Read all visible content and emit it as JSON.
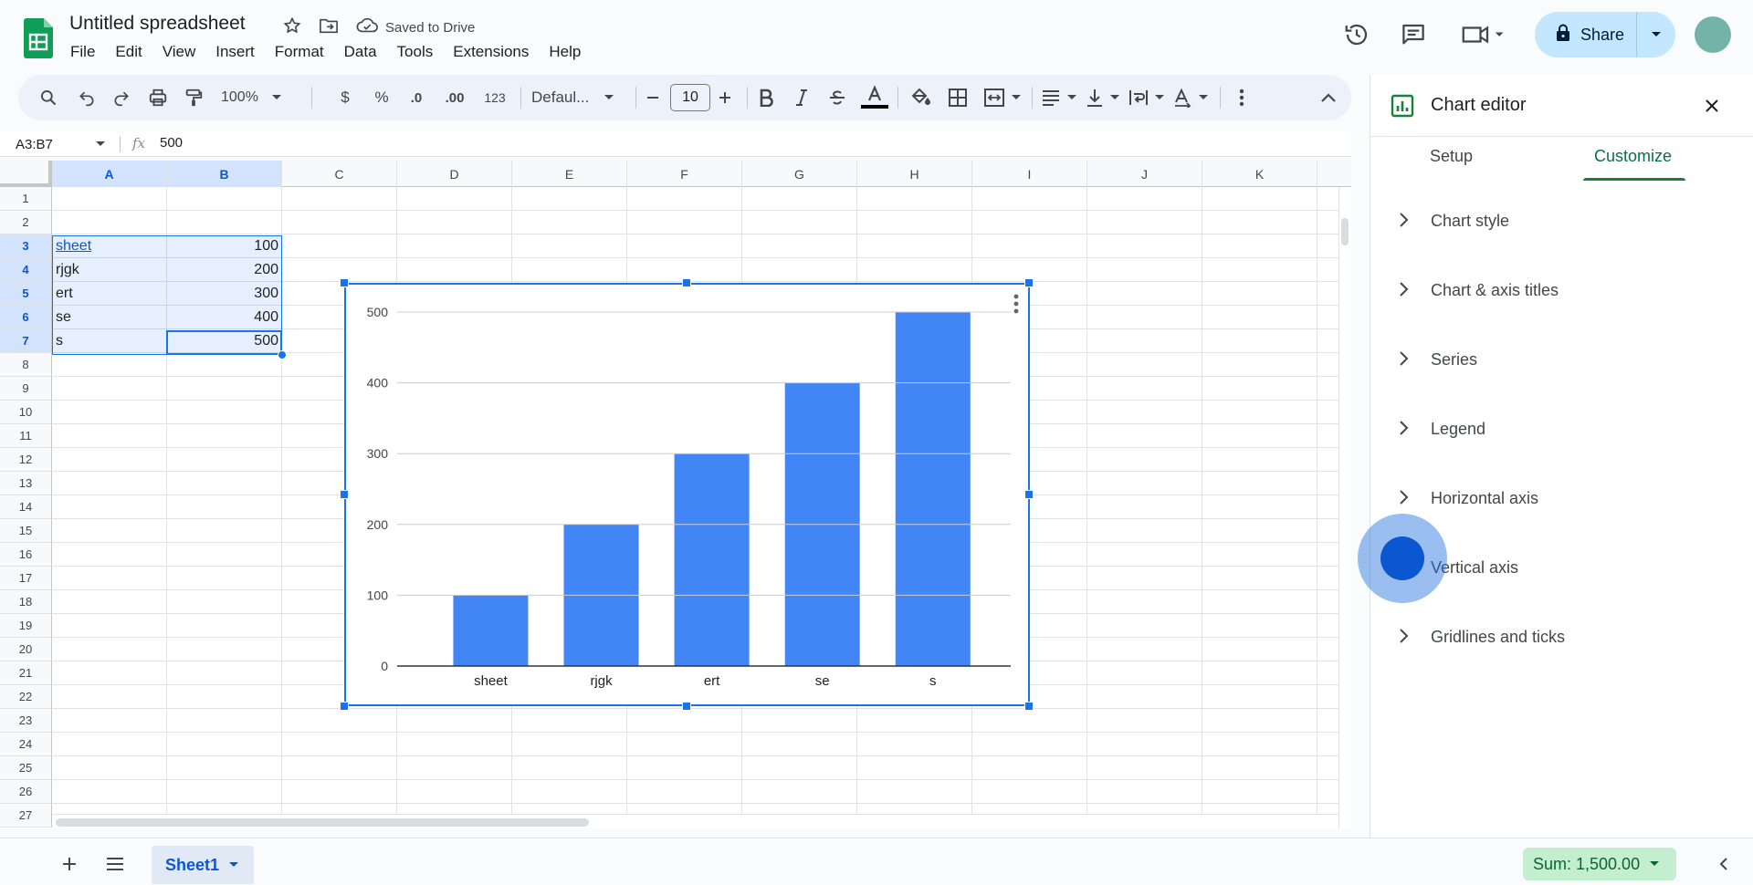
{
  "title_bar": {
    "doc_title": "Untitled spreadsheet",
    "saved_status": "Saved to Drive",
    "share_label": "Share"
  },
  "menu": [
    "File",
    "Edit",
    "View",
    "Insert",
    "Format",
    "Data",
    "Tools",
    "Extensions",
    "Help"
  ],
  "toolbar": {
    "zoom": "100%",
    "currency": "$",
    "percent": "%",
    "decrease_decimal": ".0",
    "increase_decimal": ".00",
    "number_format": "123",
    "font": "Defaul...",
    "font_size": "10"
  },
  "formula_bar": {
    "name_box": "A3:B7",
    "fx": "fx",
    "value": "500"
  },
  "grid": {
    "columns": [
      "A",
      "B",
      "C",
      "D",
      "E",
      "F",
      "G",
      "H",
      "I",
      "J",
      "K"
    ],
    "rows": [
      "1",
      "2",
      "3",
      "4",
      "5",
      "6",
      "7",
      "8",
      "9",
      "10",
      "11",
      "12",
      "13",
      "14",
      "15",
      "16",
      "17",
      "18",
      "19",
      "20",
      "21",
      "22",
      "23",
      "24",
      "25",
      "26",
      "27"
    ],
    "data": [
      {
        "row": 3,
        "a": "sheet",
        "b": "100"
      },
      {
        "row": 4,
        "a": "rjgk",
        "b": "200"
      },
      {
        "row": 5,
        "a": "ert",
        "b": "300"
      },
      {
        "row": 6,
        "a": "se",
        "b": "400"
      },
      {
        "row": 7,
        "a": "s",
        "b": "500"
      }
    ]
  },
  "chart_data": {
    "type": "bar",
    "categories": [
      "sheet",
      "rjgk",
      "ert",
      "se",
      "s"
    ],
    "values": [
      100,
      200,
      300,
      400,
      500
    ],
    "y_ticks": [
      0,
      100,
      200,
      300,
      400,
      500
    ],
    "ylim": [
      0,
      500
    ],
    "grid": true,
    "bar_color": "#4285f4",
    "title": "",
    "xlabel": "",
    "ylabel": ""
  },
  "bottom_bar": {
    "sheet_tab": "Sheet1",
    "sum": "Sum: 1,500.00"
  },
  "chart_editor": {
    "title": "Chart editor",
    "tabs": [
      "Setup",
      "Customize"
    ],
    "active_tab": "Customize",
    "sections": [
      "Chart style",
      "Chart & axis titles",
      "Series",
      "Legend",
      "Horizontal axis",
      "Vertical axis",
      "Gridlines and ticks"
    ]
  },
  "colors": {
    "accent": "#1a73e8",
    "sheets_green": "#188038",
    "share_bg": "#c2e7ff",
    "sum_bg": "#c4eed0"
  }
}
